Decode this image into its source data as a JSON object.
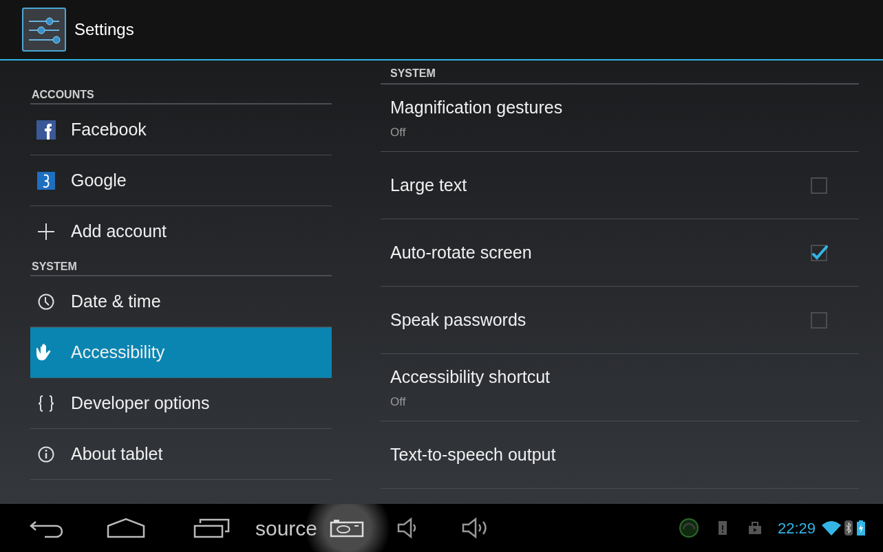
{
  "action_bar": {
    "title": "Settings"
  },
  "sidebar": {
    "sections": [
      {
        "header": "ACCOUNTS",
        "items": [
          {
            "label": "Facebook",
            "selected": false
          },
          {
            "label": "Google",
            "selected": false
          },
          {
            "label": "Add account",
            "selected": false
          }
        ]
      },
      {
        "header": "SYSTEM",
        "items": [
          {
            "label": "Date & time",
            "selected": false
          },
          {
            "label": "Accessibility",
            "selected": true
          },
          {
            "label": "Developer options",
            "selected": false
          },
          {
            "label": "About tablet",
            "selected": false
          }
        ]
      }
    ]
  },
  "detail": {
    "header": "SYSTEM",
    "rows": [
      {
        "kind": "text",
        "title": "Magnification gestures",
        "summary": "Off"
      },
      {
        "kind": "checkbox",
        "title": "Large text",
        "checked": false
      },
      {
        "kind": "checkbox",
        "title": "Auto-rotate screen",
        "checked": true
      },
      {
        "kind": "checkbox",
        "title": "Speak passwords",
        "checked": false
      },
      {
        "kind": "text",
        "title": "Accessibility shortcut",
        "summary": "Off"
      },
      {
        "kind": "text",
        "title": "Text-to-speech output"
      }
    ]
  },
  "nav_bar": {
    "source_label": "source",
    "clock": "22:29"
  }
}
